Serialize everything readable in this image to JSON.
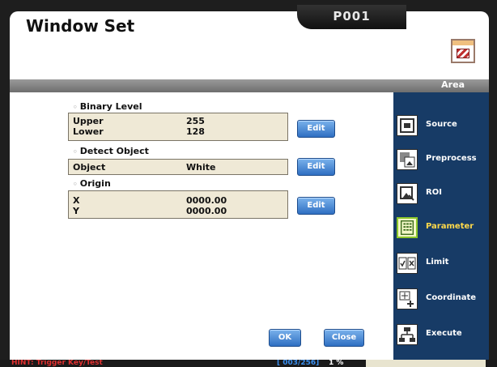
{
  "window": {
    "title": "Window Set",
    "program": "P001"
  },
  "strip": {
    "label": "Area"
  },
  "sections": {
    "binary": {
      "label": "Binary Level",
      "rows": [
        {
          "key": "Upper",
          "value": "255"
        },
        {
          "key": "Lower",
          "value": "128"
        }
      ],
      "button": "Edit"
    },
    "detect": {
      "label": "Detect Object",
      "rows": [
        {
          "key": "Object",
          "value": "White"
        }
      ],
      "button": "Edit"
    },
    "origin": {
      "label": "Origin",
      "rows": [
        {
          "key": "X",
          "value": "0000.00"
        },
        {
          "key": "Y",
          "value": "0000.00"
        }
      ],
      "button": "Edit"
    }
  },
  "footer_buttons": {
    "ok": "OK",
    "close": "Close"
  },
  "sidebar": {
    "items": [
      {
        "label": "Source",
        "icon": "source-icon"
      },
      {
        "label": "Preprocess",
        "icon": "preprocess-icon"
      },
      {
        "label": "ROI",
        "icon": "roi-icon"
      },
      {
        "label": "Parameter",
        "icon": "parameter-icon",
        "active": true
      },
      {
        "label": "Limit",
        "icon": "limit-icon"
      },
      {
        "label": "Coordinate",
        "icon": "coordinate-icon"
      },
      {
        "label": "Execute",
        "icon": "execute-icon"
      }
    ],
    "active_color": "#ffd94a"
  },
  "status": {
    "hint": "HINT: Trigger Key/Test",
    "counter": "[ 003/256]",
    "percent": "1 %"
  },
  "colors": {
    "sidebar_bg": "#173b66",
    "panel_bg": "#efe9d6",
    "button": "#2f6fc2",
    "hint": "#e03030"
  }
}
